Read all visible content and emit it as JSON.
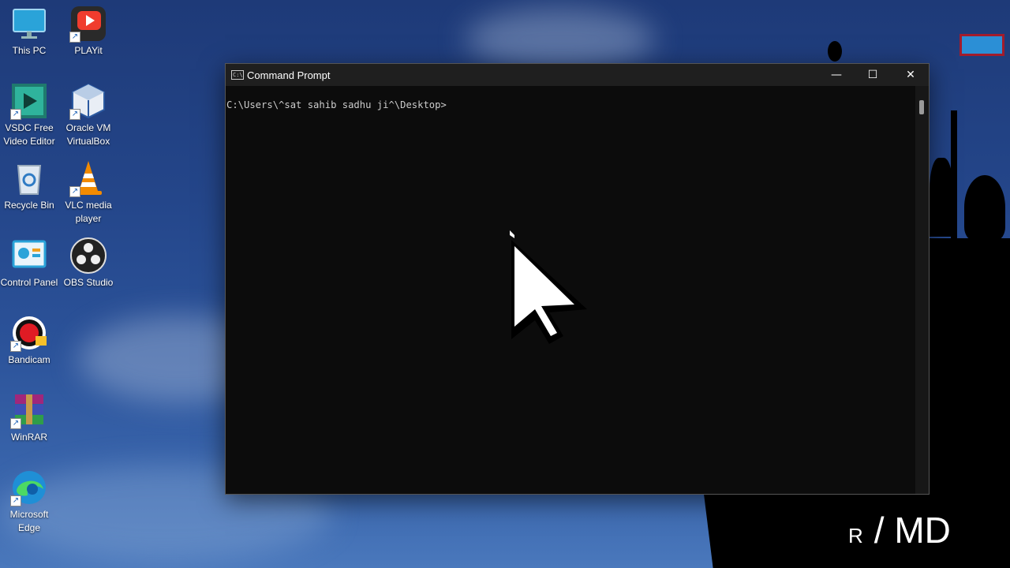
{
  "desktop": {
    "icons": [
      {
        "label": "This PC",
        "icon": "monitor-icon"
      },
      {
        "label": "PLAYit",
        "icon": "playit-icon"
      },
      {
        "label": "VSDC Free Video Editor",
        "icon": "vsdc-icon"
      },
      {
        "label": "Oracle VM VirtualBox",
        "icon": "virtualbox-icon"
      },
      {
        "label": "Recycle Bin",
        "icon": "recycle-bin-icon"
      },
      {
        "label": "VLC media player",
        "icon": "vlc-icon"
      },
      {
        "label": "Control Panel",
        "icon": "control-panel-icon"
      },
      {
        "label": "OBS Studio",
        "icon": "obs-icon"
      },
      {
        "label": "Bandicam",
        "icon": "bandicam-icon"
      },
      {
        "label": "WinRAR",
        "icon": "winrar-icon"
      },
      {
        "label": "Microsoft Edge",
        "icon": "edge-icon"
      }
    ],
    "shortcut_glyph": "↗",
    "watermark": {
      "small": "R",
      "large": "/ MD"
    }
  },
  "window": {
    "title": "Command Prompt",
    "icon_text": "C:\\",
    "controls": {
      "minimize": "—",
      "maximize": "☐",
      "close": "✕"
    },
    "prompt": "C:\\Users\\^sat sahib sadhu ji^\\Desktop>"
  },
  "colors": {
    "console_bg": "#0c0c0c",
    "console_text": "#cccccc",
    "titlebar": "#1f1f1f"
  }
}
